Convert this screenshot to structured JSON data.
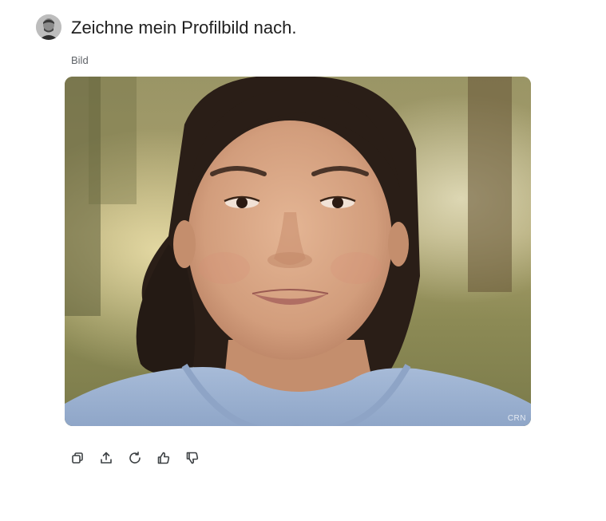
{
  "prompt": {
    "text": "Zeichne mein Profilbild nach."
  },
  "image_label": "Bild",
  "image": {
    "watermark": "CRN",
    "description_colors": {
      "background": "#8a8f5c",
      "skin": "#d9a785",
      "hair": "#2a1e17",
      "shirt": "#9fb4d4"
    }
  },
  "actions": [
    {
      "name": "copy",
      "icon": "copy-icon"
    },
    {
      "name": "share",
      "icon": "share-icon"
    },
    {
      "name": "regenerate",
      "icon": "refresh-icon"
    },
    {
      "name": "thumbs-up",
      "icon": "thumbs-up-icon"
    },
    {
      "name": "thumbs-down",
      "icon": "thumbs-down-icon"
    }
  ],
  "colors": {
    "icon_stroke": "#3c4043",
    "text": "#1f1f1f",
    "muted": "#5f6368"
  }
}
